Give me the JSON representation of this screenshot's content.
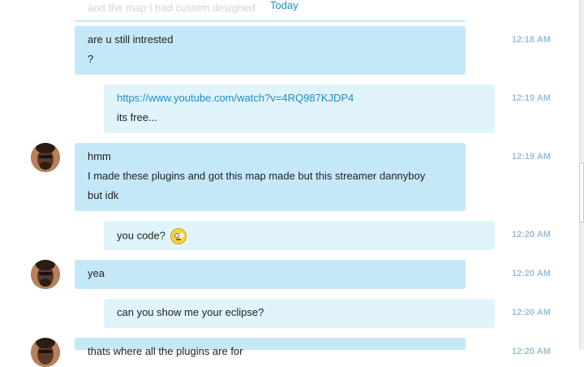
{
  "top_fragment": {
    "text": "and the map I had custom designed",
    "today": "Today"
  },
  "messages": [
    {
      "side": "me",
      "lines": [
        "are u still intrested",
        "?"
      ],
      "time": "12:18 AM"
    },
    {
      "side": "them",
      "lines": [
        "https://www.youtube.com/watch?v=4RQ987KJDP4",
        "its free..."
      ],
      "time": "12:19 AM"
    },
    {
      "side": "me",
      "lines": [
        "hmm",
        "I made these plugins and got this map made but this streamer dannyboy",
        "but idk"
      ],
      "time": "12:19 AM"
    },
    {
      "side": "them",
      "lines": [
        "you code?"
      ],
      "time": "12:20 AM",
      "emoji": "confused-smile-icon"
    },
    {
      "side": "me",
      "lines": [
        "yea"
      ],
      "time": "12:20 AM"
    },
    {
      "side": "them",
      "lines": [
        "can you show me your eclipse?"
      ],
      "time": "12:20 AM"
    },
    {
      "side": "me",
      "lines": [
        "thats where all the plugins are for"
      ],
      "time": "12:20 AM"
    }
  ],
  "colors": {
    "my_bubble": "#c5e8f9",
    "their_bubble": "#e1f4fc",
    "link": "#1a8fc5",
    "timestamp": "#9bbfd2"
  }
}
